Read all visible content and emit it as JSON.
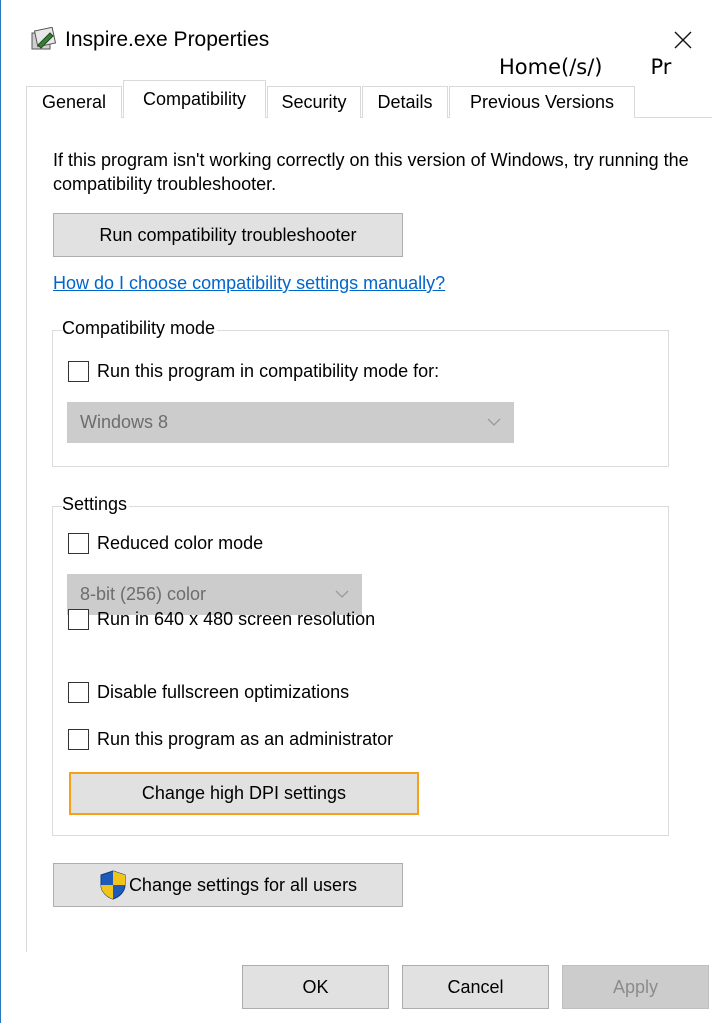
{
  "window": {
    "title": "Inspire.exe Properties",
    "icon": "program-icon",
    "close_glyph": "✕"
  },
  "overlay": {
    "crumbs": [
      "Home(/s/)",
      "Pr"
    ]
  },
  "tabs": [
    {
      "label": "General"
    },
    {
      "label": "Compatibility",
      "active": true
    },
    {
      "label": "Security"
    },
    {
      "label": "Details"
    },
    {
      "label": "Previous Versions"
    }
  ],
  "intro": {
    "text": "If this program isn't working correctly on this version of Windows, try running the compatibility troubleshooter."
  },
  "buttons": {
    "troubleshooter": "Run compatibility troubleshooter",
    "high_dpi": "Change high DPI settings",
    "all_users": "Change settings for all users",
    "ok": "OK",
    "cancel": "Cancel",
    "apply": "Apply"
  },
  "link": {
    "manual": "How do I choose compatibility settings manually?"
  },
  "compat_mode": {
    "legend": "Compatibility mode",
    "checkbox_label": "Run this program in compatibility mode for:",
    "checked": false,
    "selected_os": "Windows 8"
  },
  "settings": {
    "legend": "Settings",
    "reduced_color": {
      "label": "Reduced color mode",
      "checked": false
    },
    "color_depth": "8-bit (256) color",
    "res640": {
      "label": "Run in 640 x 480 screen resolution",
      "checked": false
    },
    "fullscreen": {
      "label": "Disable fullscreen optimizations",
      "checked": false
    },
    "admin": {
      "label": "Run this program as an administrator",
      "checked": false
    }
  },
  "colors": {
    "accent_focus": "#f7a11a",
    "link": "#0066cc",
    "window_border": "#2b79c4"
  }
}
